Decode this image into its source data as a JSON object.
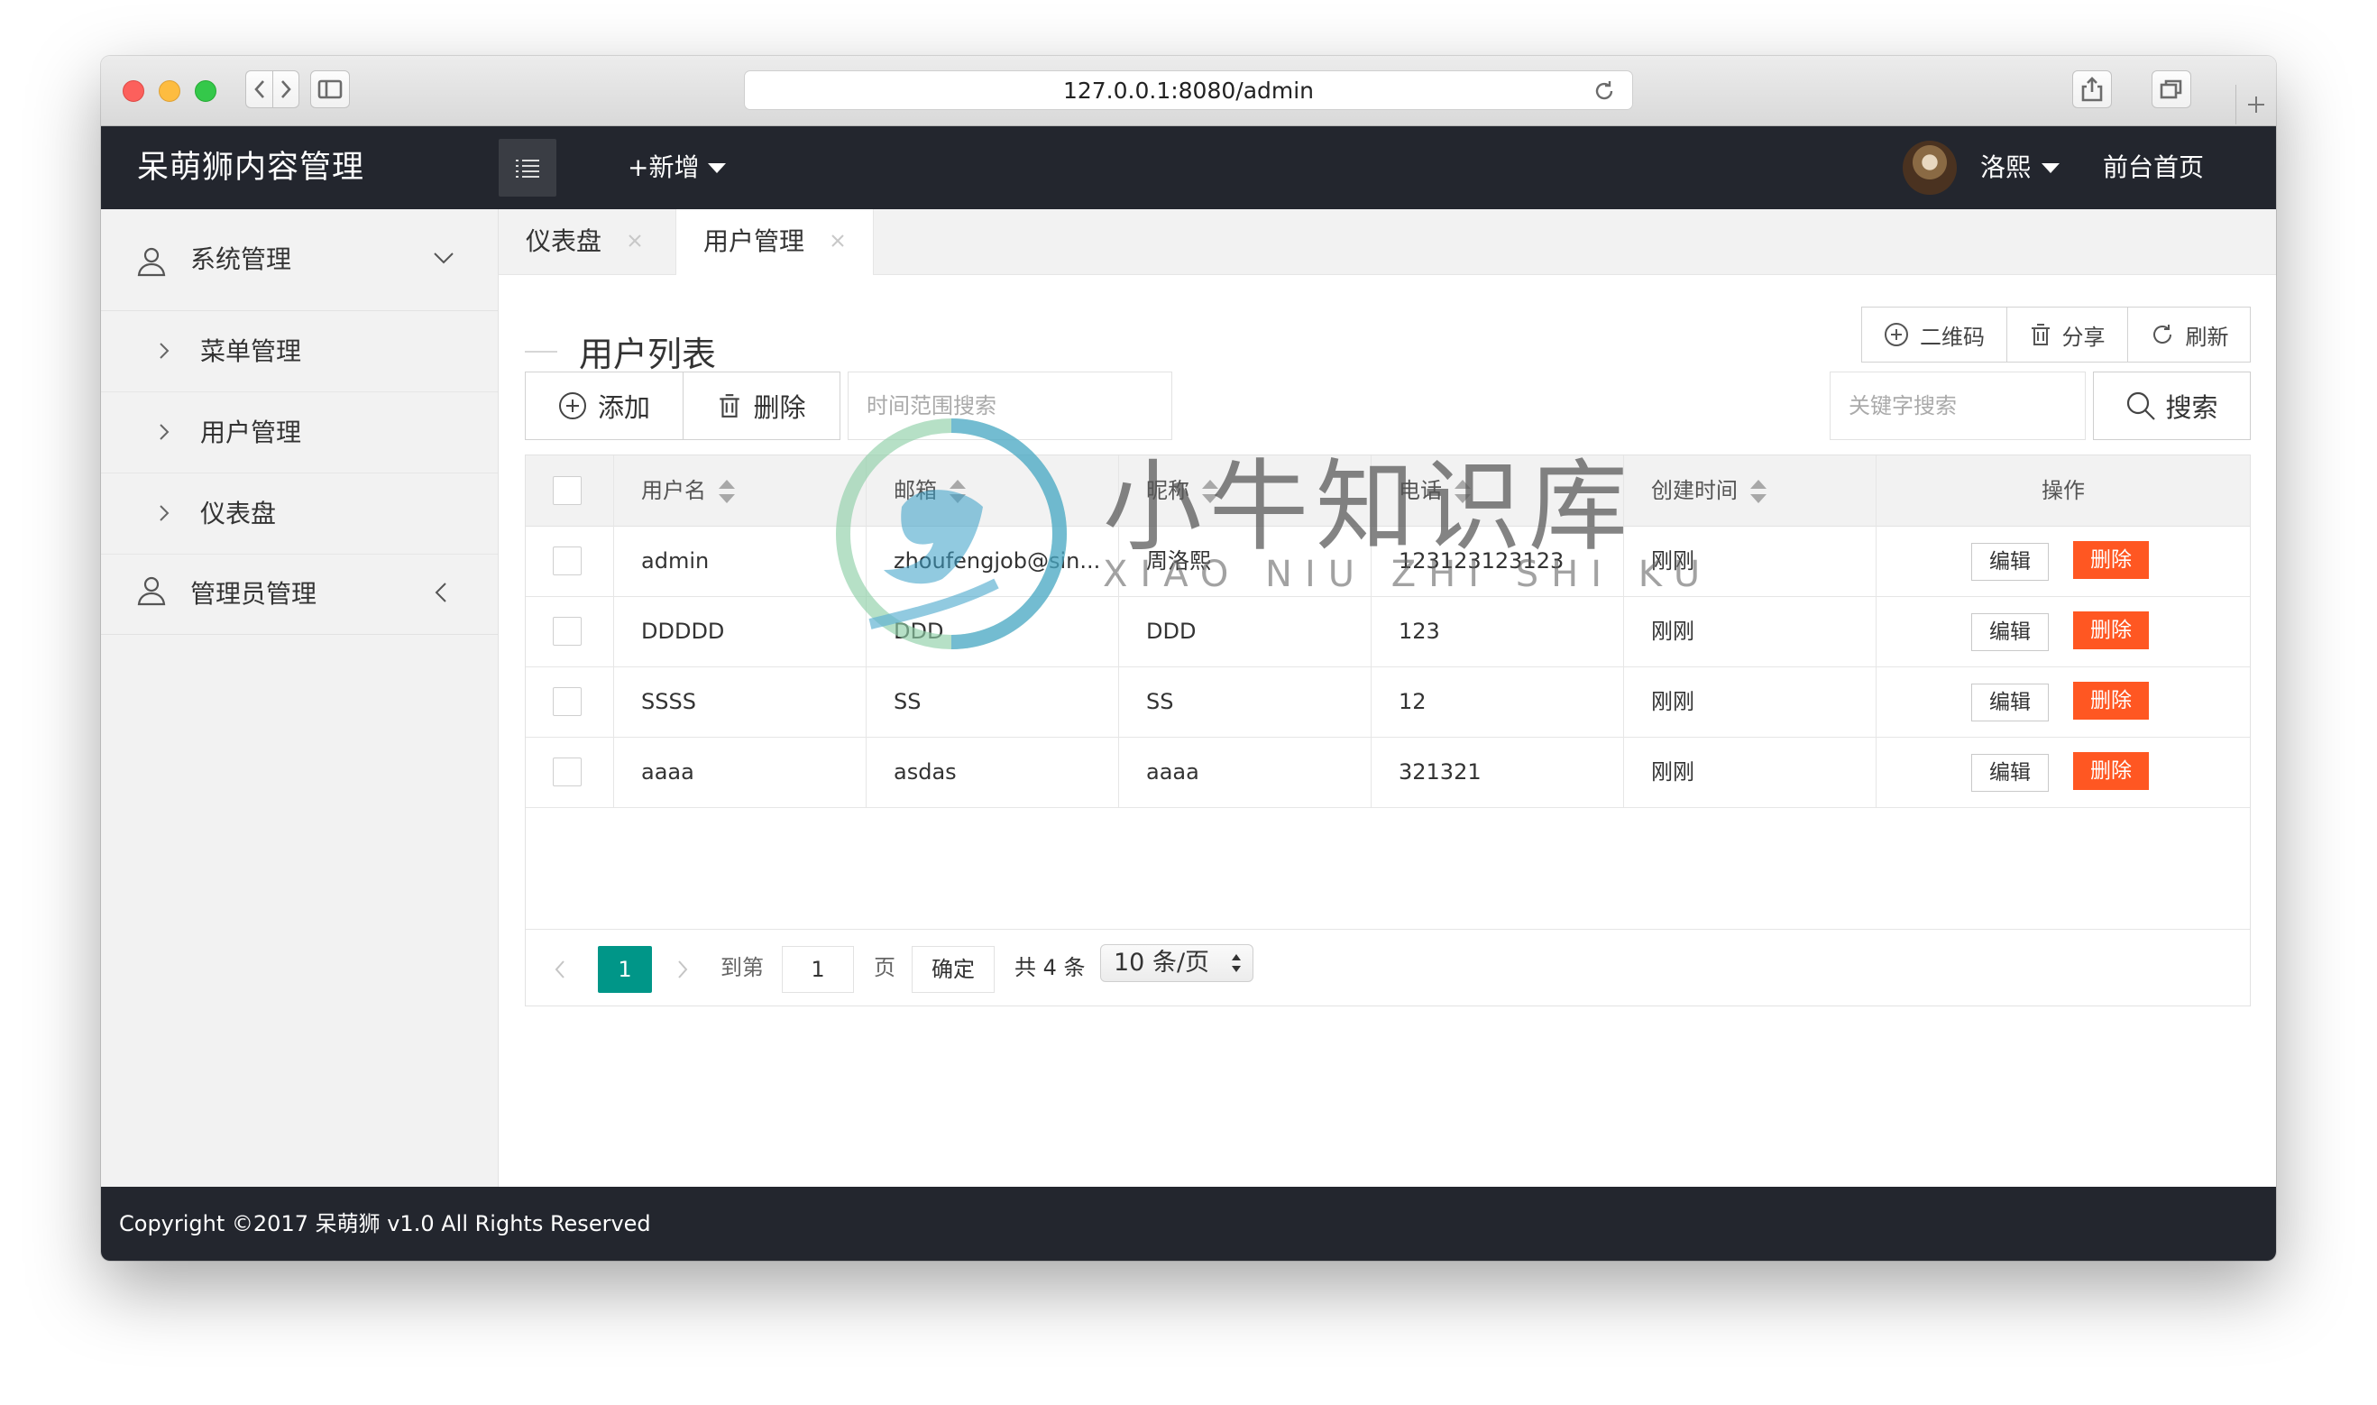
{
  "browser": {
    "url": "127.0.0.1:8080/admin"
  },
  "header": {
    "logo": "呆萌狮内容管理",
    "add_new": "+新增",
    "username": "洛熙",
    "front_link": "前台首页"
  },
  "sidebar": {
    "group1": {
      "label": "系统管理",
      "icon": "user-icon",
      "arrow": "chevron-down-icon"
    },
    "items": [
      {
        "label": "菜单管理"
      },
      {
        "label": "用户管理"
      },
      {
        "label": "仪表盘"
      }
    ],
    "group2": {
      "label": "管理员管理",
      "icon": "user-icon",
      "arrow": "chevron-left-icon"
    }
  },
  "tabs": [
    {
      "label": "仪表盘",
      "active": false
    },
    {
      "label": "用户管理",
      "active": true
    }
  ],
  "page": {
    "title": "用户列表",
    "top_actions": {
      "qrcode": "二维码",
      "share": "分享",
      "refresh": "刷新"
    },
    "add_button": "添加",
    "delete_button": "删除",
    "time_search_placeholder": "时间范围搜索",
    "keyword_placeholder": "关键字搜索",
    "search_button": "搜索"
  },
  "table": {
    "headers": [
      "用户名",
      "邮箱",
      "昵称",
      "电话",
      "创建时间",
      "操作"
    ],
    "rows": [
      {
        "username": "admin",
        "email": "zhoufengjob@sin...",
        "nickname": "周洛熙",
        "phone": "123123123123",
        "created": "刚刚"
      },
      {
        "username": "DDDDD",
        "email": "DDD",
        "nickname": "DDD",
        "phone": "123",
        "created": "刚刚"
      },
      {
        "username": "SSSS",
        "email": "SS",
        "nickname": "SS",
        "phone": "12",
        "created": "刚刚"
      },
      {
        "username": "aaaa",
        "email": "asdas",
        "nickname": "aaaa",
        "phone": "321321",
        "created": "刚刚"
      }
    ],
    "edit_label": "编辑",
    "delete_label": "删除"
  },
  "pager": {
    "current": "1",
    "goto_label": "到第",
    "goto_value": "1",
    "page_label": "页",
    "confirm": "确定",
    "total": "共 4 条",
    "page_size": "10 条/页"
  },
  "footer": {
    "copyright": "Copyright ©2017 呆萌狮 v1.0 All Rights Reserved"
  },
  "watermark": {
    "title": "小牛知识库",
    "subtitle": "XIAO NIU ZHI SHI KU"
  },
  "colors": {
    "header_bg": "#23262e",
    "accent": "#009688",
    "danger": "#ff5722"
  }
}
